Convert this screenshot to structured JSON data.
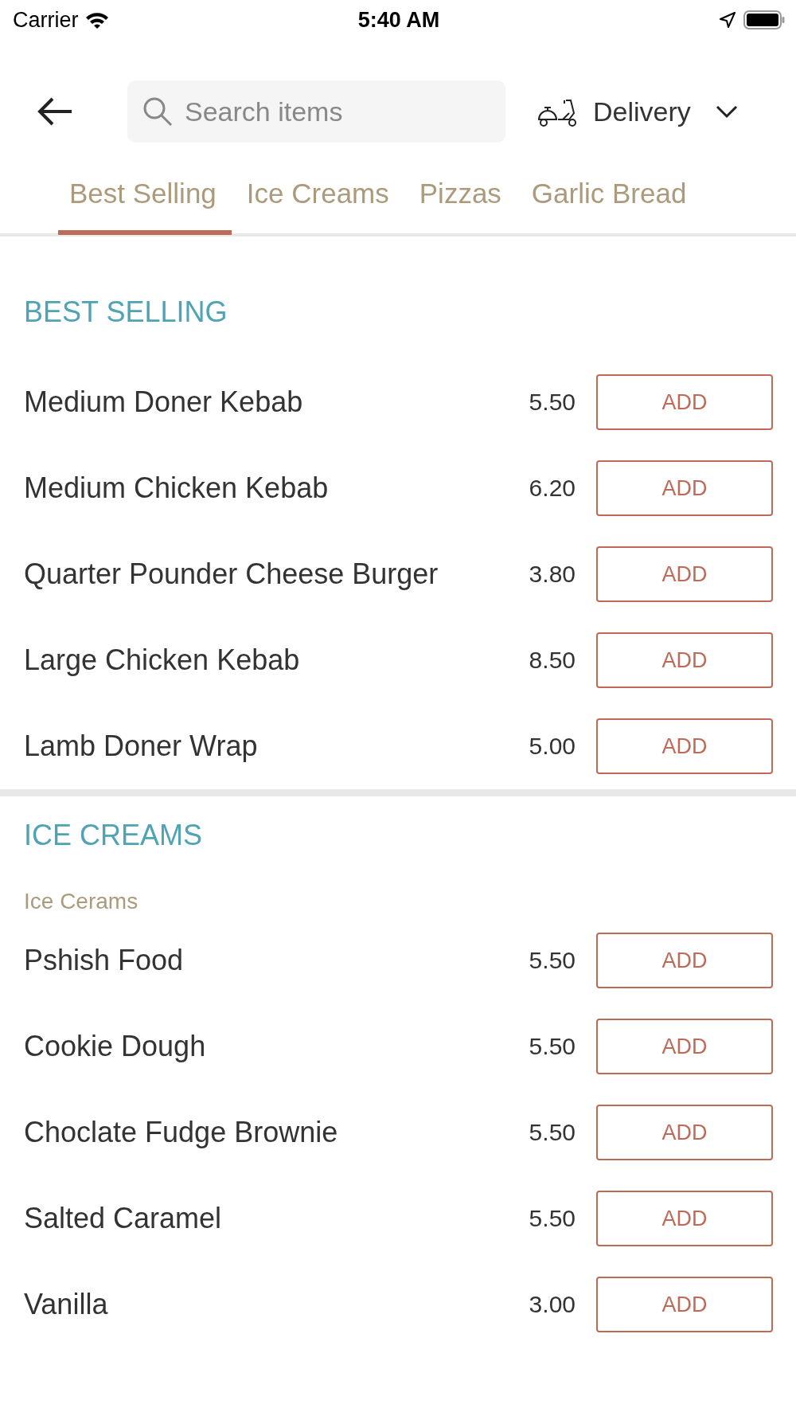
{
  "status_bar": {
    "carrier": "Carrier",
    "time": "5:40 AM"
  },
  "header": {
    "search": {
      "placeholder": "Search items"
    },
    "order_type": "Delivery"
  },
  "tabs": [
    {
      "label": "Best Selling",
      "selected": true
    },
    {
      "label": "Ice Creams",
      "selected": false
    },
    {
      "label": "Pizzas",
      "selected": false
    },
    {
      "label": "Garlic Bread",
      "selected": false
    }
  ],
  "sections": [
    {
      "title": "BEST SELLING",
      "items": [
        {
          "name": "Medium Doner Kebab",
          "price": "5.50",
          "button": "ADD"
        },
        {
          "name": "Medium Chicken Kebab",
          "price": "6.20",
          "button": "ADD"
        },
        {
          "name": "Quarter Pounder Cheese Burger",
          "price": "3.80",
          "button": "ADD"
        },
        {
          "name": "Large Chicken Kebab",
          "price": "8.50",
          "button": "ADD"
        },
        {
          "name": "Lamb Doner Wrap",
          "price": "5.00",
          "button": "ADD"
        }
      ]
    },
    {
      "title": "ICE CREAMS",
      "subtitle": "Ice Cerams",
      "items": [
        {
          "name": "Pshish Food",
          "price": "5.50",
          "button": "ADD"
        },
        {
          "name": "Cookie Dough",
          "price": "5.50",
          "button": "ADD"
        },
        {
          "name": "Choclate Fudge Brownie",
          "price": "5.50",
          "button": "ADD"
        },
        {
          "name": "Salted Caramel",
          "price": "5.50",
          "button": "ADD"
        },
        {
          "name": "Vanilla",
          "price": "3.00",
          "button": "ADD"
        }
      ]
    }
  ]
}
